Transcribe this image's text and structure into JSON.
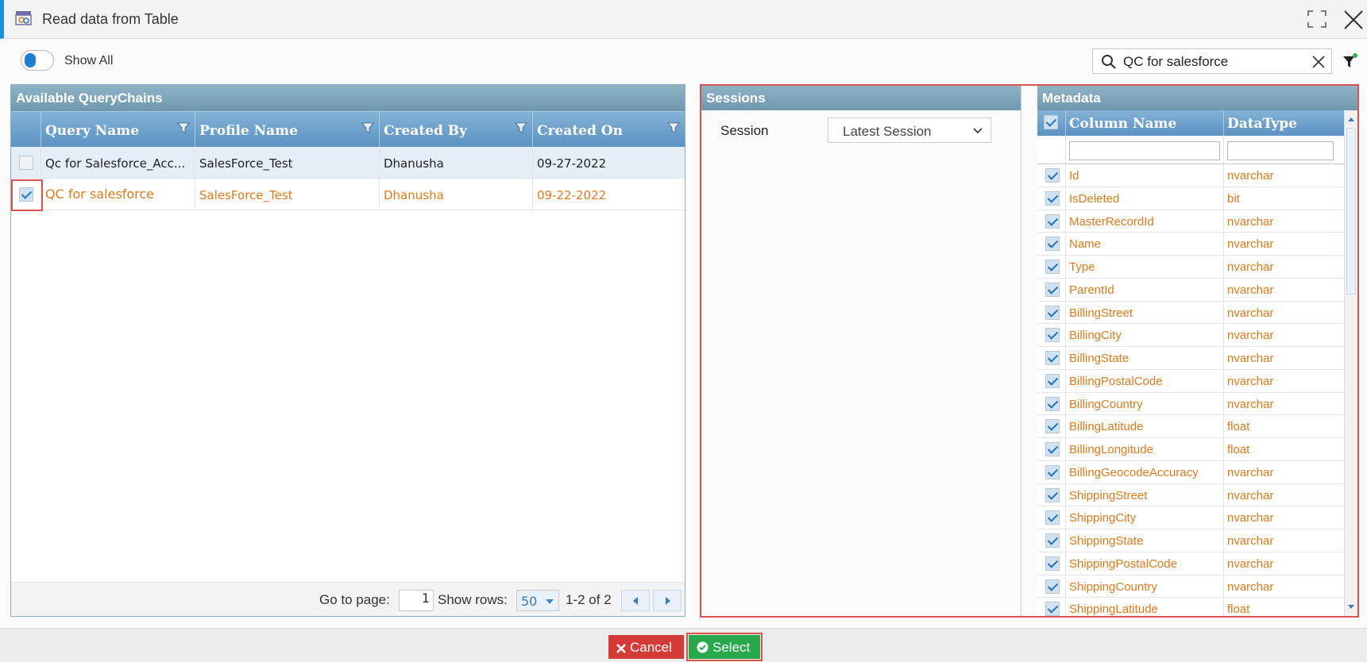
{
  "window": {
    "title": "Read data from Table"
  },
  "toolbar": {
    "show_all_label": "Show All",
    "search_value": "QC for salesforce"
  },
  "query_chains": {
    "title": "Available QueryChains",
    "columns": [
      "Query Name",
      "Profile Name",
      "Created By",
      "Created On"
    ],
    "rows": [
      {
        "query_name": "Qc for Salesforce_Acc...",
        "profile_name": "SalesForce_Test",
        "created_by": "Dhanusha",
        "created_on": "09-27-2022",
        "checked": false
      },
      {
        "query_name": "QC for salesforce",
        "profile_name": "SalesForce_Test",
        "created_by": "Dhanusha",
        "created_on": "09-22-2022",
        "checked": true
      }
    ],
    "pager": {
      "go_to_label": "Go to page:",
      "page": "1",
      "show_rows_label": "Show rows:",
      "rows_per_page": "50",
      "range": "1-2 of 2"
    }
  },
  "sessions": {
    "title": "Sessions",
    "session_label": "Session",
    "session_value": "Latest Session"
  },
  "metadata": {
    "title": "Metadata",
    "columns": [
      "Column Name",
      "DataType"
    ],
    "rows": [
      {
        "name": "Id",
        "type": "nvarchar"
      },
      {
        "name": "IsDeleted",
        "type": "bit"
      },
      {
        "name": "MasterRecordId",
        "type": "nvarchar"
      },
      {
        "name": "Name",
        "type": "nvarchar"
      },
      {
        "name": "Type",
        "type": "nvarchar"
      },
      {
        "name": "ParentId",
        "type": "nvarchar"
      },
      {
        "name": "BillingStreet",
        "type": "nvarchar"
      },
      {
        "name": "BillingCity",
        "type": "nvarchar"
      },
      {
        "name": "BillingState",
        "type": "nvarchar"
      },
      {
        "name": "BillingPostalCode",
        "type": "nvarchar"
      },
      {
        "name": "BillingCountry",
        "type": "nvarchar"
      },
      {
        "name": "BillingLatitude",
        "type": "float"
      },
      {
        "name": "BillingLongitude",
        "type": "float"
      },
      {
        "name": "BillingGeocodeAccuracy",
        "type": "nvarchar"
      },
      {
        "name": "ShippingStreet",
        "type": "nvarchar"
      },
      {
        "name": "ShippingCity",
        "type": "nvarchar"
      },
      {
        "name": "ShippingState",
        "type": "nvarchar"
      },
      {
        "name": "ShippingPostalCode",
        "type": "nvarchar"
      },
      {
        "name": "ShippingCountry",
        "type": "nvarchar"
      },
      {
        "name": "ShippingLatitude",
        "type": "float"
      }
    ]
  },
  "footer": {
    "cancel_label": "Cancel",
    "select_label": "Select"
  },
  "colors": {
    "accent_orange": "#d97a1f",
    "header_blue": "#5c92c2",
    "cancel_red": "#d43b36",
    "select_green": "#27a84a",
    "highlight_red": "#d9534f"
  }
}
